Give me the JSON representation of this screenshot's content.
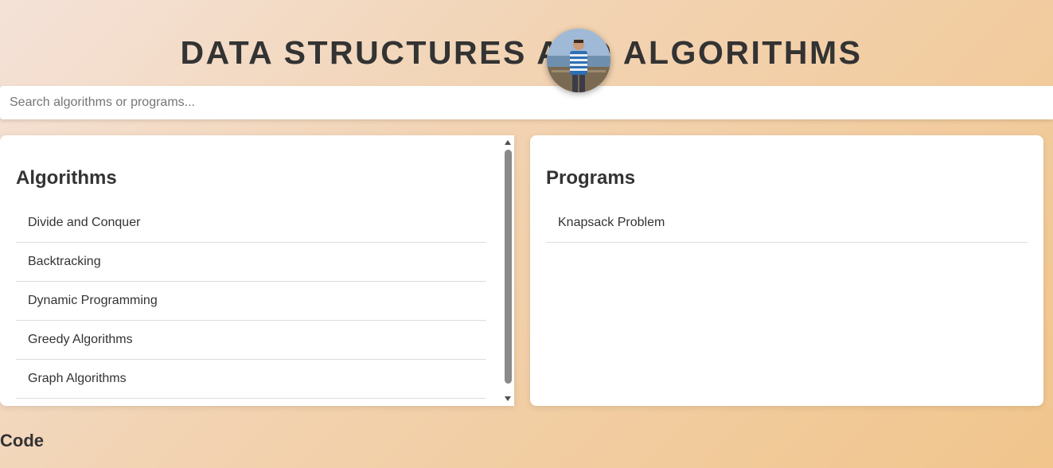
{
  "header": {
    "title": "DATA STRUCTURES AND ALGORITHMS"
  },
  "search": {
    "placeholder": "Search algorithms or programs...",
    "value": ""
  },
  "algorithms": {
    "heading": "Algorithms",
    "items": [
      "Divide and Conquer",
      "Backtracking",
      "Dynamic Programming",
      "Greedy Algorithms",
      "Graph Algorithms"
    ]
  },
  "programs": {
    "heading": "Programs",
    "items": [
      "Knapsack Problem"
    ]
  },
  "code": {
    "heading": "Code"
  }
}
